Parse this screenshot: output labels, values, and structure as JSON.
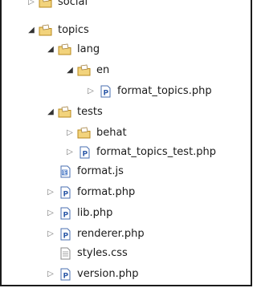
{
  "tree": {
    "items": [
      {
        "label": "social",
        "icon": "folder-package-icon",
        "expanded": false
      },
      {
        "label": "topics",
        "icon": "folder-package-icon",
        "expanded": true
      },
      {
        "label": "lang",
        "icon": "folder-package-icon",
        "expanded": true
      },
      {
        "label": "en",
        "icon": "folder-package-icon",
        "expanded": true
      },
      {
        "label": "format_topics.php",
        "icon": "php-file-icon",
        "expanded": false
      },
      {
        "label": "tests",
        "icon": "folder-package-icon",
        "expanded": true
      },
      {
        "label": "behat",
        "icon": "folder-package-icon",
        "expanded": false
      },
      {
        "label": "format_topics_test.php",
        "icon": "php-file-icon",
        "expanded": false
      },
      {
        "label": "format.js",
        "icon": "js-file-icon"
      },
      {
        "label": "format.php",
        "icon": "php-file-icon",
        "expanded": false
      },
      {
        "label": "lib.php",
        "icon": "php-file-icon",
        "expanded": false
      },
      {
        "label": "renderer.php",
        "icon": "php-file-icon",
        "expanded": false
      },
      {
        "label": "styles.css",
        "icon": "css-file-icon"
      },
      {
        "label": "version.php",
        "icon": "php-file-icon",
        "expanded": false
      }
    ]
  },
  "colors": {
    "folder_fill": "#f2d37c",
    "folder_stroke": "#b88a1e",
    "file_border": "#4a6fb0",
    "php_letter": "#2e5aa8"
  }
}
